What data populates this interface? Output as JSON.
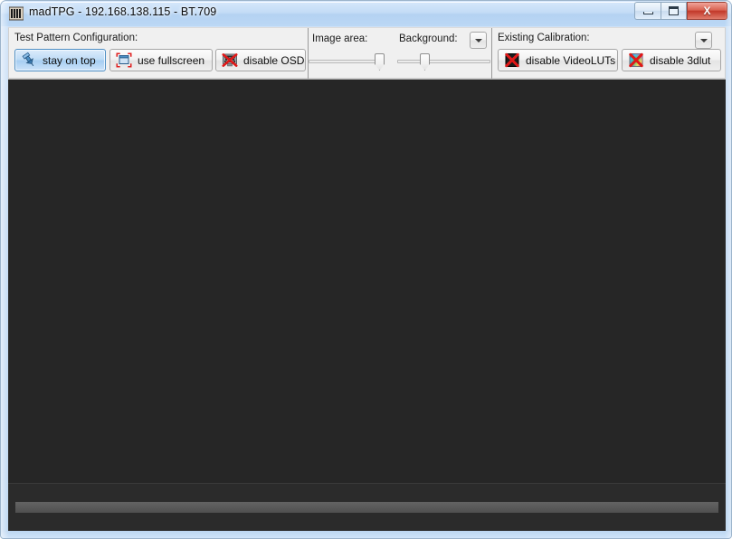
{
  "window": {
    "title": "madTPG  -  192.168.138.115  -  BT.709",
    "app_icon": "madtpg-logo-icon",
    "controls": {
      "minimize_label": "–",
      "maximize_label": "□",
      "close_label": "X",
      "minimize_name": "minimize-button",
      "maximize_name": "maximize-button",
      "close_name": "close-button"
    },
    "frame_color": "#bcd6f1",
    "titlebar_color": "#c4dcf6"
  },
  "toolbar": {
    "groups": [
      {
        "label": "Test Pattern Configuration:",
        "buttons": [
          {
            "label": "stay on top",
            "icon": "pushpin-icon",
            "active": true
          },
          {
            "label": "use fullscreen",
            "icon": "fullscreen-icon",
            "active": false
          },
          {
            "label": "disable OSD",
            "icon": "osd-disabled-icon",
            "active": false
          }
        ]
      },
      {
        "label_image_area": "Image area:",
        "label_background": "Background:",
        "sliders": [
          {
            "name": "image-area-slider",
            "value": 79
          },
          {
            "name": "background-slider",
            "value": 31
          }
        ],
        "dropdown_label": "▼"
      },
      {
        "label": "Existing Calibration:",
        "dropdown_label": "▼",
        "buttons": [
          {
            "label": "disable VideoLUTs",
            "icon": "videoluts-disabled-icon",
            "active": false
          },
          {
            "label": "disable 3dlut",
            "icon": "lut3d-disabled-icon",
            "active": false
          }
        ]
      }
    ]
  },
  "canvas": {
    "name": "test-pattern-canvas",
    "color": "#262626"
  },
  "bottom": {
    "name": "signal-level-bar",
    "color": "#5a5a5a"
  }
}
